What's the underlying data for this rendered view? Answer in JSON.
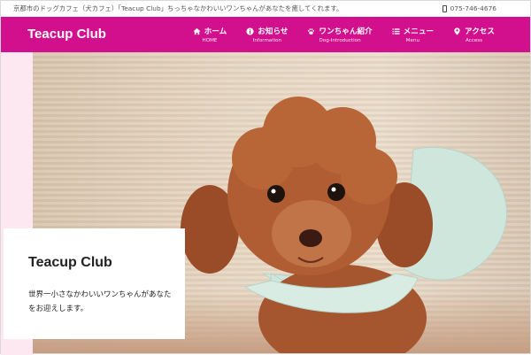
{
  "topbar": {
    "tagline": "京都市のドッグカフェ（犬カフェ）「Teacup Club」ちっちゃなかわいいワンちゃんがあなたを癒してくれます。",
    "phone": "075-746-4676"
  },
  "header": {
    "logo": "Teacup Club",
    "nav": [
      {
        "label": "ホーム",
        "sub": "HOME",
        "icon": "home-icon"
      },
      {
        "label": "お知らせ",
        "sub": "Information",
        "icon": "info-icon"
      },
      {
        "label": "ワンちゃん紹介",
        "sub": "Dog-Introduction",
        "icon": "paw-icon"
      },
      {
        "label": "メニュー",
        "sub": "Menu",
        "icon": "list-icon"
      },
      {
        "label": "アクセス",
        "sub": "Access",
        "icon": "map-pin-icon"
      }
    ]
  },
  "hero": {
    "title": "Teacup Club",
    "text": "世界一小さなかわいいワンちゃんがあなたをお迎えします。"
  },
  "colors": {
    "brand": "#d20f8c",
    "strip": "#fde8f1"
  }
}
